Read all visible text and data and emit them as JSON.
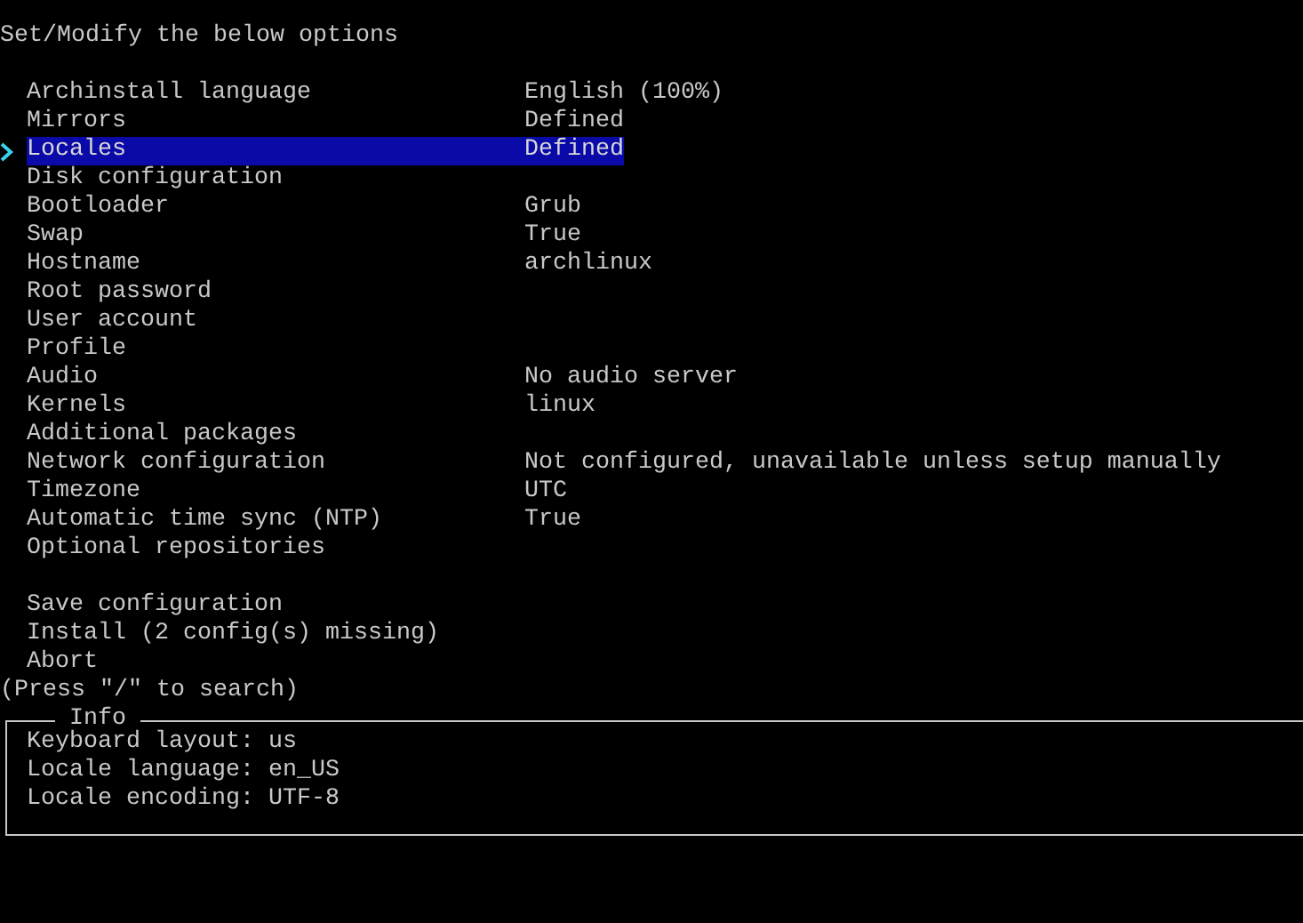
{
  "title": "Set/Modify the below options",
  "options": [
    {
      "label": "Archinstall language",
      "value": "English (100%)",
      "selected": false
    },
    {
      "label": "Mirrors",
      "value": "Defined",
      "selected": false
    },
    {
      "label": "Locales",
      "value": "Defined",
      "selected": true
    },
    {
      "label": "Disk configuration",
      "selected": false
    },
    {
      "label": "Bootloader",
      "value": "Grub",
      "selected": false
    },
    {
      "label": "Swap",
      "value": "True",
      "selected": false
    },
    {
      "label": "Hostname",
      "value": "archlinux",
      "selected": false
    },
    {
      "label": "Root password",
      "selected": false
    },
    {
      "label": "User account",
      "selected": false
    },
    {
      "label": "Profile",
      "selected": false
    },
    {
      "label": "Audio",
      "value": "No audio server",
      "selected": false
    },
    {
      "label": "Kernels",
      "value": "linux",
      "selected": false
    },
    {
      "label": "Additional packages",
      "selected": false
    },
    {
      "label": "Network configuration",
      "value": "Not configured, unavailable unless setup manually",
      "selected": false
    },
    {
      "label": "Timezone",
      "value": "UTC",
      "selected": false
    },
    {
      "label": "Automatic time sync (NTP)",
      "value": "True",
      "selected": false
    },
    {
      "label": "Optional repositories",
      "selected": false
    }
  ],
  "actions": [
    {
      "label": "Save configuration",
      "selected": false
    },
    {
      "label": "Install (2 config(s) missing)",
      "selected": false
    },
    {
      "label": "Abort",
      "selected": false
    }
  ],
  "search_hint": "(Press \"/\" to search)",
  "info": {
    "title": "Info",
    "lines": [
      "Keyboard layout: us",
      "Locale language: en_US",
      "Locale encoding: UTF-8"
    ]
  }
}
